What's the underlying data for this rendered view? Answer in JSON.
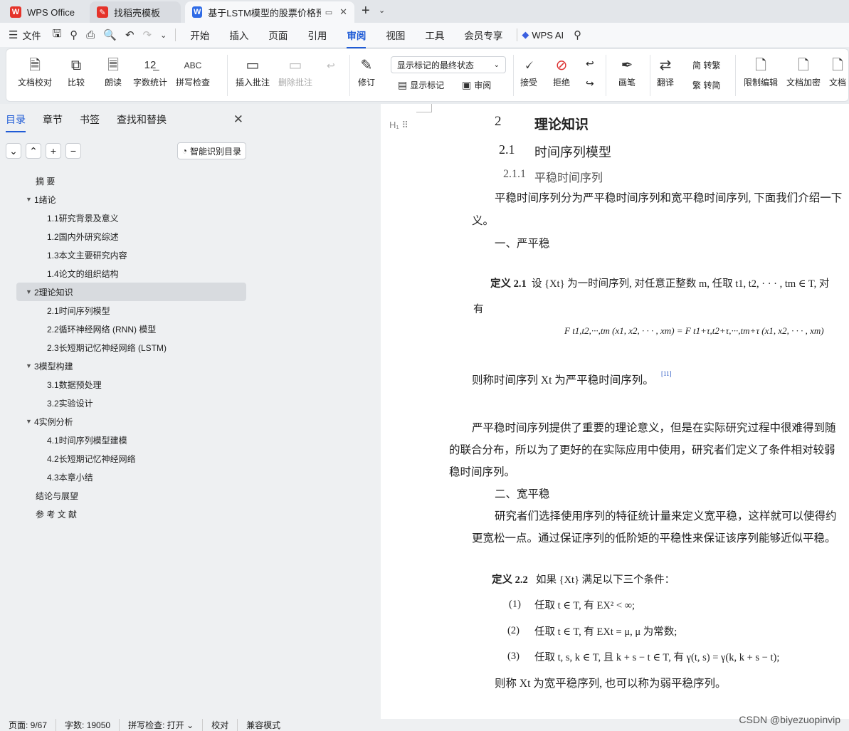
{
  "tabs": [
    {
      "label": "WPS Office",
      "icon": "wps-logo-icon"
    },
    {
      "label": "找稻壳模板",
      "icon": "docer-icon"
    },
    {
      "label": "基于LSTM模型的股票价格预测",
      "icon": "writer-icon"
    }
  ],
  "menu": {
    "file": "文件",
    "items": [
      "开始",
      "插入",
      "页面",
      "引用",
      "审阅",
      "视图",
      "工具",
      "会员专享"
    ],
    "active": "审阅",
    "wps_ai": "WPS AI"
  },
  "ribbon": {
    "doc_proof": "文档校对",
    "compare": "比较",
    "read_aloud": "朗读",
    "word_count": "字数统计",
    "spell_check": "拼写检查",
    "insert_comment": "插入批注",
    "delete_comment": "删除批注",
    "revise": "修订",
    "markup_state": "显示标记的最终状态",
    "show_markup": "显示标记",
    "review": "审阅",
    "accept": "接受",
    "reject": "拒绝",
    "pen": "画笔",
    "translate": "翻译",
    "to_traditional": "简 转繁",
    "to_simplified": "繁 转简",
    "restrict_edit": "限制编辑",
    "encrypt": "文档加密",
    "doc_more": "文档"
  },
  "sidebar": {
    "tabs": [
      "目录",
      "章节",
      "书签",
      "查找和替换"
    ],
    "smart_toc": "智能识别目录",
    "toc": [
      {
        "label": "摘 要",
        "level": 0
      },
      {
        "label": "1绪论",
        "level": 1
      },
      {
        "label": "1.1研究背景及意义",
        "level": 2
      },
      {
        "label": "1.2国内外研究综述",
        "level": 2
      },
      {
        "label": "1.3本文主要研究内容",
        "level": 2
      },
      {
        "label": "1.4论文的组织结构",
        "level": 2
      },
      {
        "label": "2理论知识",
        "level": 1,
        "selected": true
      },
      {
        "label": "2.1时间序列模型",
        "level": 2
      },
      {
        "label": "2.2循环神经网络 (RNN) 模型",
        "level": 2
      },
      {
        "label": "2.3长短期记忆神经网络 (LSTM)",
        "level": 2
      },
      {
        "label": "3模型构建",
        "level": 1
      },
      {
        "label": "3.1数据预处理",
        "level": 2
      },
      {
        "label": "3.2实验设计",
        "level": 2
      },
      {
        "label": "4实例分析",
        "level": 1
      },
      {
        "label": "4.1时间序列模型建模",
        "level": 2
      },
      {
        "label": "4.2长短期记忆神经网络",
        "level": 2
      },
      {
        "label": "4.3本章小结",
        "level": 2
      },
      {
        "label": "结论与展望",
        "level": 0
      },
      {
        "label": "参 考 文 献",
        "level": 0
      }
    ]
  },
  "document": {
    "h1_num": "2",
    "h1": "理论知识",
    "h2_num": "2.1",
    "h2": "时间序列模型",
    "h3_num": "2.1.1",
    "h3": "平稳时间序列",
    "p1a": "平稳时间序列分为严平稳时间序列和宽平稳时间序列, 下面我们介绍一下",
    "p1b": "义。",
    "strict": "一、严平稳",
    "def1_label": "定义 2.1",
    "def1": "设 {Xt} 为一时间序列, 对任意正整数 m, 任取 t1, t2, · · · , tm ∈ T, 对",
    "def1_b": "有",
    "formula1": "F t1,t2,···,tm (x1, x2, · · · , xm) = F t1+τ,t2+τ,···,tm+τ (x1, x2, · · · , xm)",
    "p_strict": "则称时间序列  Xt 为严平稳时间序列。",
    "cite": "[11]",
    "p2a": "严平稳时间序列提供了重要的理论意义，但是在实际研究过程中很难得到随",
    "p2b": "的联合分布，所以为了更好的在实际应用中使用，研究者们定义了条件相对较弱",
    "p2c": "稳时间序列。",
    "wide": "二、宽平稳",
    "p3a": "研究者们选择使用序列的特征统计量来定义宽平稳，这样就可以使得约",
    "p3b": "更宽松一点。通过保证序列的低阶矩的平稳性来保证该序列能够近似平稳。",
    "def2_label": "定义 2.2",
    "def2": "如果 {Xt} 满足以下三个条件：",
    "c1_num": "(1)",
    "c1": "任取 t ∈ T, 有 EX² < ∞;",
    "c2_num": "(2)",
    "c2": "任取 t ∈ T, 有 EXt = μ, μ 为常数;",
    "c3_num": "(3)",
    "c3": "任取 t, s, k ∈ T, 且 k + s − t ∈ T, 有 γ(t, s) = γ(k, k + s − t);",
    "p_wide": "则称  Xt 为宽平稳序列, 也可以称为弱平稳序列。"
  },
  "status": {
    "page": "页面: 9/67",
    "words": "字数: 19050",
    "spell": "拼写检查: 打开 ⌄",
    "proof": "校对",
    "compat": "兼容模式"
  },
  "watermark": "CSDN @biyezuopinvip"
}
